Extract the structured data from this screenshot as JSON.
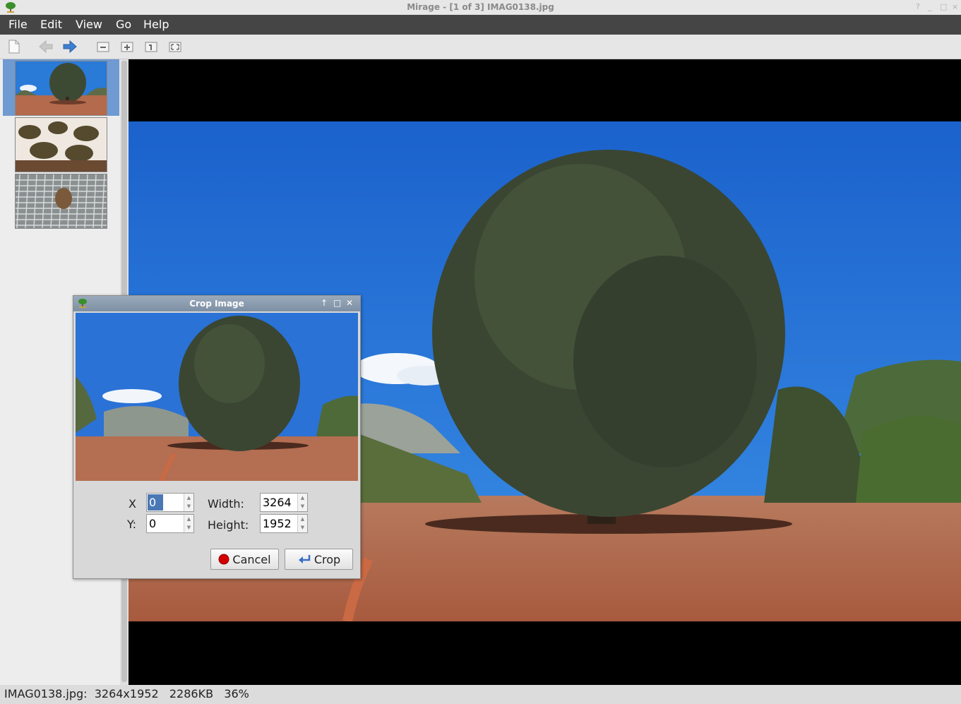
{
  "window": {
    "title": "Mirage - [1 of 3] IMAG0138.jpg",
    "wm_buttons": [
      "?",
      "_",
      "□",
      "×"
    ]
  },
  "menu": {
    "items": [
      "File",
      "Edit",
      "View",
      "Go",
      "Help"
    ]
  },
  "thumbnails": {
    "count": 3,
    "selected_index": 0
  },
  "status": {
    "text": "IMAG0138.jpg:  3264x1952   2286KB   36%"
  },
  "dialog": {
    "title": "Crop Image",
    "x_label": "X",
    "y_label": "Y:",
    "width_label": "Width:",
    "height_label": "Height:",
    "x_value": "0",
    "y_value": "0",
    "width_value": "3264",
    "height_value": "1952",
    "cancel_label": "Cancel",
    "crop_label": "Crop"
  },
  "colors": {
    "menubar": "#454545",
    "selection": "#6f9ad2",
    "sky": "#1f6fd0",
    "ground": "#b06848"
  }
}
